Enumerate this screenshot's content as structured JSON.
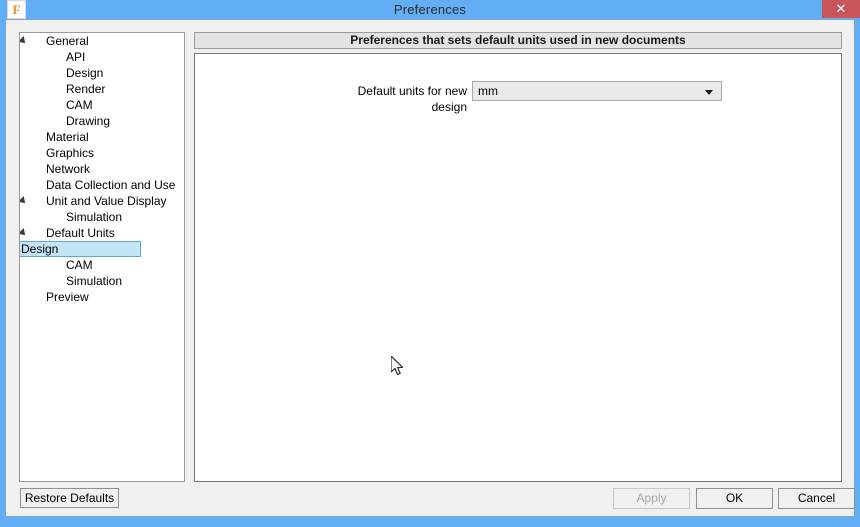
{
  "window": {
    "title": "Preferences",
    "app_icon": "fusion-f-icon",
    "app_icon_letter": "F",
    "close_label": "✕",
    "frame_color": "#62AEF4",
    "close_color": "#C9545C"
  },
  "sidebar": {
    "items": [
      {
        "label": "General",
        "level": 0,
        "expandable": true,
        "expanded": true,
        "selected": false
      },
      {
        "label": "API",
        "level": 1,
        "expandable": false,
        "expanded": false,
        "selected": false
      },
      {
        "label": "Design",
        "level": 1,
        "expandable": false,
        "expanded": false,
        "selected": false
      },
      {
        "label": "Render",
        "level": 1,
        "expandable": false,
        "expanded": false,
        "selected": false
      },
      {
        "label": "CAM",
        "level": 1,
        "expandable": false,
        "expanded": false,
        "selected": false
      },
      {
        "label": "Drawing",
        "level": 1,
        "expandable": false,
        "expanded": false,
        "selected": false
      },
      {
        "label": "Material",
        "level": 0,
        "expandable": false,
        "expanded": false,
        "selected": false
      },
      {
        "label": "Graphics",
        "level": 0,
        "expandable": false,
        "expanded": false,
        "selected": false
      },
      {
        "label": "Network",
        "level": 0,
        "expandable": false,
        "expanded": false,
        "selected": false
      },
      {
        "label": "Data Collection and Use",
        "level": 0,
        "expandable": false,
        "expanded": false,
        "selected": false
      },
      {
        "label": "Unit and Value Display",
        "level": 0,
        "expandable": true,
        "expanded": true,
        "selected": false
      },
      {
        "label": "Simulation",
        "level": 1,
        "expandable": false,
        "expanded": false,
        "selected": false
      },
      {
        "label": "Default Units",
        "level": 0,
        "expandable": true,
        "expanded": true,
        "selected": false
      },
      {
        "label": "Design",
        "level": 1,
        "expandable": false,
        "expanded": false,
        "selected": true
      },
      {
        "label": "CAM",
        "level": 1,
        "expandable": false,
        "expanded": false,
        "selected": false
      },
      {
        "label": "Simulation",
        "level": 1,
        "expandable": false,
        "expanded": false,
        "selected": false
      },
      {
        "label": "Preview",
        "level": 0,
        "expandable": false,
        "expanded": false,
        "selected": false
      }
    ],
    "selection_color": "#C3E5F6"
  },
  "content": {
    "header": "Preferences that sets default units used in new documents",
    "field_label": "Default units for new design",
    "combo_value": "mm"
  },
  "footer": {
    "restore_defaults": "Restore Defaults",
    "apply": "Apply",
    "apply_enabled": false,
    "ok": "OK",
    "cancel": "Cancel"
  }
}
